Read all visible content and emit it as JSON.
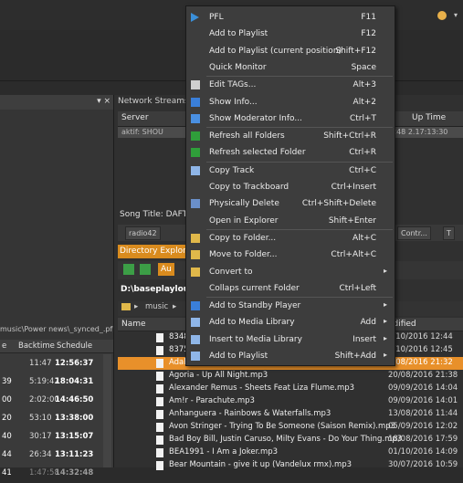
{
  "network_streams": {
    "tab": "Network Streams",
    "col_server": "Server",
    "col_uptime": "Up Time",
    "row_text": "aktif: SHOU",
    "row_right": "248  2.17:13:30"
  },
  "song_title": "Song Title: DAFT",
  "radio": {
    "left": "radio42",
    "right1": "Contr...",
    "right2": "T"
  },
  "directory": {
    "tab": "Directory Explore",
    "toolbar_label": "Au",
    "path": "D:\\baseplayloud",
    "breadcrumb": "music",
    "col_name": "Name",
    "col_modified": "odified"
  },
  "left_panel": {
    "path": "music\\Power news\\_synced_.pfp",
    "headers": [
      "e",
      "Backtime",
      "Schedule"
    ],
    "rows": [
      {
        "a": "",
        "b": "11:47",
        "c": "12:56:37"
      },
      {
        "a": "39",
        "b": "5:19:42",
        "c": "18:04:31"
      },
      {
        "a": "00",
        "b": "2:02:00",
        "c": "14:46:50"
      },
      {
        "a": "20",
        "b": "53:10",
        "c": "13:38:00"
      },
      {
        "a": "40",
        "b": "30:17",
        "c": "13:15:07"
      },
      {
        "a": "44",
        "b": "26:34",
        "c": "13:11:23"
      },
      {
        "a": "41",
        "b": "1:47:58",
        "c": "14:32:48"
      }
    ]
  },
  "files": [
    {
      "name": "8348",
      "date": "9/10/2016 12:44",
      "selected": false
    },
    {
      "name": "8375",
      "date": "9/10/2016 12:45",
      "selected": false
    },
    {
      "name": "Adal",
      "date": "1/08/2016 21:32",
      "selected": true
    },
    {
      "name": "Agoria - Up All Night.mp3",
      "date": "20/08/2016 21:38",
      "selected": false
    },
    {
      "name": "Alexander Remus - Sheets Feat Liza Flume.mp3",
      "date": "09/09/2016 14:04",
      "selected": false
    },
    {
      "name": "Am!r - Parachute.mp3",
      "date": "09/09/2016 14:01",
      "selected": false
    },
    {
      "name": "Anhanguera - Rainbows & Waterfalls.mp3",
      "date": "13/08/2016 11:44",
      "selected": false
    },
    {
      "name": "Avon Stringer - Trying To Be Someone (Saison Remix).mp3",
      "date": "05/09/2016 12:02",
      "selected": false
    },
    {
      "name": "Bad Boy Bill, Justin Caruso, Milty Evans - Do Your Thing.mp3",
      "date": "18/08/2016 17:59",
      "selected": false
    },
    {
      "name": "BEA1991 - I Am a Joker.mp3",
      "date": "01/10/2016 14:09",
      "selected": false
    },
    {
      "name": "Bear Mountain - give it up (Vandelux rmx).mp3",
      "date": "30/07/2016 10:59",
      "selected": false
    }
  ],
  "menu": {
    "items": [
      {
        "label": "PFL",
        "shortcut": "F11",
        "icon": "play-icon",
        "color": "#3a8fd9"
      },
      {
        "label": "Add to Playlist",
        "shortcut": "F12"
      },
      {
        "label": "Add to Playlist (current position)",
        "shortcut": "Shift+F12"
      },
      {
        "label": "Quick Monitor",
        "shortcut": "Space"
      },
      {
        "label": "Edit TAGs...",
        "shortcut": "Alt+3",
        "icon": "edit-tags-icon",
        "color": "#d0d0d0"
      },
      {
        "label": "Show Info...",
        "shortcut": "Alt+2",
        "icon": "info-icon",
        "color": "#3a7fd9"
      },
      {
        "label": "Show Moderator Info...",
        "shortcut": "Ctrl+T",
        "icon": "moderator-icon",
        "color": "#4a90e2"
      },
      {
        "label": "Refresh all Folders",
        "shortcut": "Shift+Ctrl+R",
        "icon": "refresh-all-icon",
        "color": "#2f9e3a"
      },
      {
        "label": "Refresh selected Folder",
        "shortcut": "Ctrl+R",
        "icon": "refresh-icon",
        "color": "#2f9e3a"
      },
      {
        "label": "Copy Track",
        "shortcut": "Ctrl+C",
        "icon": "copy-icon",
        "color": "#8fb6e8"
      },
      {
        "label": "Copy to Trackboard",
        "shortcut": "Ctrl+Insert"
      },
      {
        "label": "Physically Delete",
        "shortcut": "Ctrl+Shift+Delete",
        "icon": "delete-icon",
        "color": "#6a8fc9"
      },
      {
        "label": "Open in Explorer",
        "shortcut": "Shift+Enter"
      },
      {
        "label": "Copy to Folder...",
        "shortcut": "Alt+C",
        "icon": "copy-folder-icon",
        "color": "#e0b84a"
      },
      {
        "label": "Move to Folder...",
        "shortcut": "Ctrl+Alt+C",
        "icon": "move-folder-icon",
        "color": "#e0b84a"
      },
      {
        "label": "Convert to",
        "shortcut": "",
        "icon": "convert-icon",
        "color": "#e0b84a",
        "submenu": true
      },
      {
        "label": "Collaps current Folder",
        "shortcut": "Ctrl+Left"
      },
      {
        "label": "Add to Standby Player",
        "shortcut": "",
        "icon": "standby-icon",
        "color": "#3a7fd9",
        "submenu": true
      },
      {
        "label": "Add to Media Library",
        "shortcut": "Add",
        "icon": "media-add-icon",
        "color": "#8fb6e8",
        "submenu": true
      },
      {
        "label": "Insert to Media Library",
        "shortcut": "Insert",
        "icon": "media-insert-icon",
        "color": "#8fb6e8",
        "submenu": true
      },
      {
        "label": "Add to Playlist",
        "shortcut": "Shift+Add",
        "icon": "playlist-add-icon",
        "color": "#8fb6e8",
        "submenu": true
      }
    ]
  }
}
